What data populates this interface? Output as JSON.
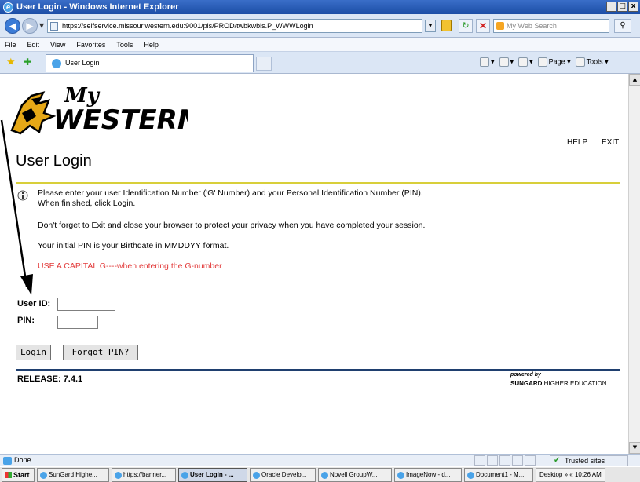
{
  "window": {
    "title": "User Login - Windows Internet Explorer",
    "controls": [
      "_",
      "□",
      "x"
    ]
  },
  "address_bar": {
    "url": "https://selfservice.missouriwestern.edu:9001/pls/PROD/twbkwbis.P_WWWLogin",
    "search_placeholder": "My Web Search"
  },
  "menu": [
    "File",
    "Edit",
    "View",
    "Favorites",
    "Tools",
    "Help"
  ],
  "tab": {
    "label": "User Login"
  },
  "command_bar": {
    "page": "Page",
    "tools": "Tools"
  },
  "page": {
    "logo_my": "My",
    "logo_western": "WESTERN",
    "help_link": "HELP",
    "exit_link": "EXIT",
    "title": "User Login",
    "info": {
      "line1": "Please enter your user Identification Number ('G' Number) and your Personal Identification Number (PIN).",
      "line2": "When finished, click Login.",
      "line3": "Don't forget to Exit and close your browser to protect your privacy when you have completed your session.",
      "line4": "Your initial PIN is your Birthdate in MMDDYY format.",
      "line5": "USE A CAPITAL G----when entering the G-number"
    },
    "form": {
      "user_id_label": "User ID:",
      "user_id_value": "",
      "pin_label": "PIN:",
      "pin_value": "",
      "login_button": "Login",
      "forgot_pin_button": "Forgot PIN?"
    },
    "release": "RELEASE: 7.4.1",
    "powered_by": "powered by",
    "sungard": "SUNGARD",
    "higher_ed": " HIGHER EDUCATION"
  },
  "status_bar": {
    "text": "Done",
    "zone": "Trusted sites"
  },
  "taskbar": {
    "start": "Start",
    "tasks": [
      "SunGard Highe...",
      "https://banner...",
      "User Login - ...",
      "Oracle Develo...",
      "Novell GroupW...",
      "ImageNow - d...",
      "Document1 - M..."
    ],
    "desktop": "Desktop",
    "time": "10:26 AM"
  },
  "colors": {
    "accent_rule": "#d8cf3a",
    "footer_rule": "#1f3f6f",
    "warning_text": "#e23a3a",
    "logo_gold": "#e6a817"
  }
}
